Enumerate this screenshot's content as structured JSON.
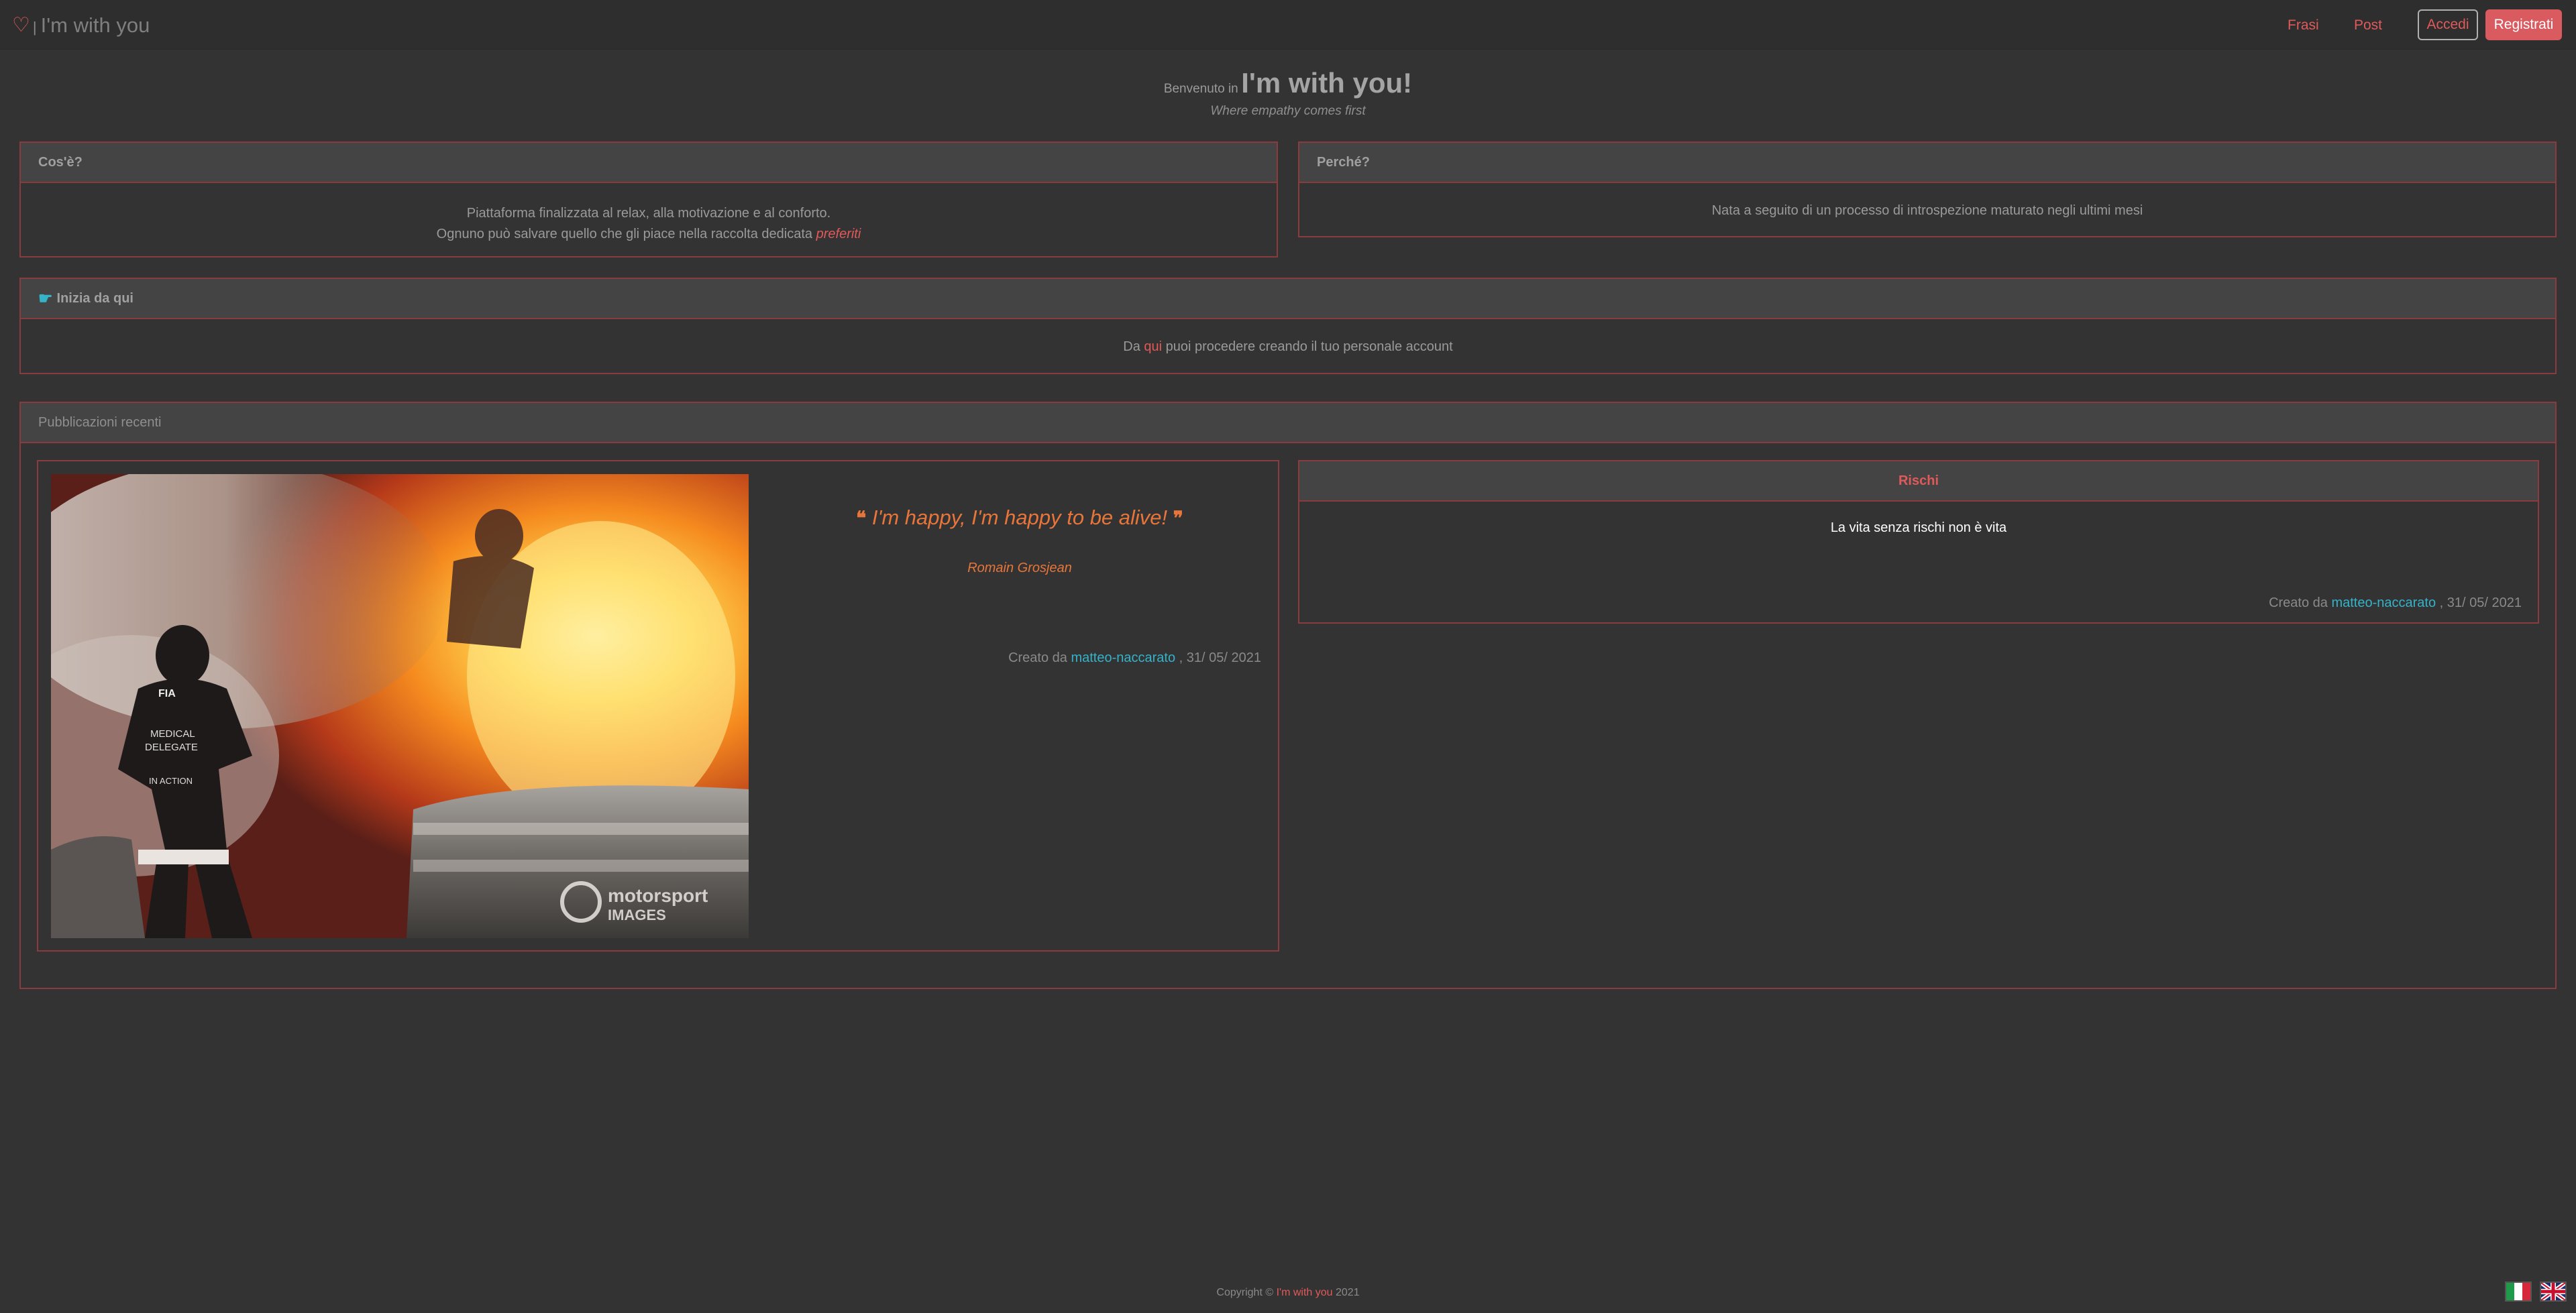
{
  "navbar": {
    "brand_separator": "|",
    "brand_title": "I'm with you",
    "links": {
      "frasi": "Frasi",
      "post": "Post"
    },
    "login_label": "Accedi",
    "register_label": "Registrati",
    "accent_color": "#e05a5a"
  },
  "welcome": {
    "prefix": "Benvenuto in",
    "app_name": "I'm with you!",
    "tagline": "Where empathy comes first"
  },
  "cards": {
    "what": {
      "title": "Cos'è?",
      "line1": "Piattaforma finalizzata al relax, alla motivazione e al conforto.",
      "line2_prefix": "Ognuno può salvare quello che gli piace nella raccolta dedicata",
      "line2_link": "preferiti"
    },
    "why": {
      "title": "Perché?",
      "text": "Nata a seguito di un processo di introspezione maturato negli ultimi mesi"
    },
    "start": {
      "icon": "hand-point-right-icon",
      "title": "Inizia da qui",
      "text_prefix": "Da",
      "link": "qui",
      "text_suffix": "puoi procedere creando il tuo personale account"
    }
  },
  "recent": {
    "title": "Pubblicazioni recenti",
    "post_card": {
      "image_watermark_line1": "motorsport",
      "image_watermark_line2": "IMAGES",
      "suit_text": [
        "FIA",
        "MEDICAL",
        "DELEGATE",
        "IN ACTION"
      ],
      "quote": "I'm happy, I'm happy to be alive!",
      "quote_author": "Romain Grosjean",
      "created_prefix": "Creato da",
      "created_user": "matteo-naccarato",
      "created_date": ", 31/ 05/ 2021"
    },
    "phrase_card": {
      "title": "Rischi",
      "text": "La vita senza rischi non è vita",
      "created_prefix": "Creato da",
      "created_user": "matteo-naccarato",
      "created_date": ", 31/ 05/ 2021"
    }
  },
  "footer": {
    "prefix": "Copyright ©",
    "link": "I'm with you",
    "year": "2021"
  },
  "languages": [
    "italian-flag-icon",
    "uk-flag-icon"
  ]
}
